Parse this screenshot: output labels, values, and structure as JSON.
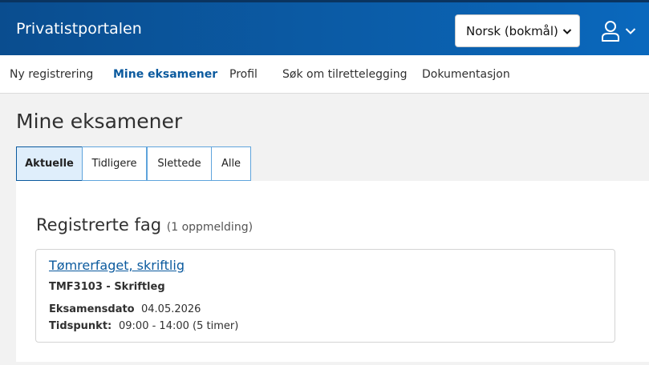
{
  "header": {
    "brand": "Privatistportalen",
    "language_selected": "Norsk (bokmål)"
  },
  "nav": {
    "items": [
      {
        "label": "Ny registrering"
      },
      {
        "label": "Mine eksamener"
      },
      {
        "label": "Profil"
      },
      {
        "label": "Søk om tilrettelegging"
      },
      {
        "label": "Dokumentasjon"
      }
    ],
    "active": "Mine eksamener"
  },
  "page": {
    "title": "Mine eksamener",
    "tabs": [
      {
        "label": "Aktuelle"
      },
      {
        "label": "Tidligere"
      },
      {
        "label": "Slettede"
      },
      {
        "label": "Alle"
      }
    ],
    "active_tab": "Aktuelle"
  },
  "registered": {
    "title": "Registrerte fag",
    "count": "(1 oppmelding)",
    "exam": {
      "name": "Tømrerfaget, skriftlig",
      "code": "TMF3103 - Skriftleg",
      "date_label": "Eksamensdato",
      "date_value": "04.05.2026",
      "time_label": "Tidspunkt:",
      "time_value": "09:00 - 14:00 (5 timer)"
    }
  },
  "colors": {
    "header_bg": "#0b5ca7",
    "accent": "#0b5a9e",
    "tab_active_bg": "#dfeefb"
  }
}
